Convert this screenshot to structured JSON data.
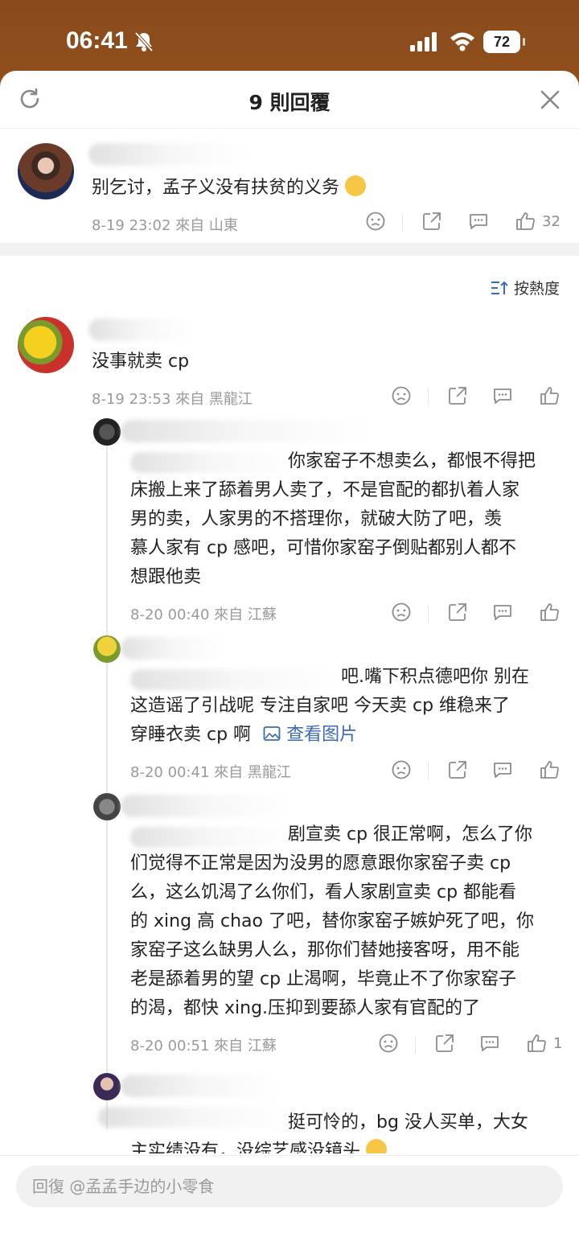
{
  "status_bar": {
    "time": "06:41",
    "battery": "72"
  },
  "header": {
    "title": "9 則回覆"
  },
  "root_comment": {
    "text": "别乞讨，孟子义没有扶贫的义务",
    "meta": "8-19 23:02  來自 山東",
    "likes": "32"
  },
  "sort_label": "按熱度",
  "comments": [
    {
      "text": "没事就卖 cp",
      "meta": "8-19 23:53  來自 黑龍江",
      "likes": ""
    }
  ],
  "replies": [
    {
      "lines": [
        "你家窑子不想卖么，都恨不得把",
        "床搬上来了舔着男人卖了，不是官配的都扒着人家",
        "男的卖，人家男的不搭理你，就破大防了吧，羡",
        "慕人家有 cp 感吧，可惜你家窑子倒贴都别人都不",
        "想跟他卖"
      ],
      "meta": "8-20 00:40  來自 江蘇",
      "likes": ""
    },
    {
      "lines": [
        "吧.嘴下积点德吧你  别在",
        "这造谣了引战呢 专注自家吧 今天卖 cp 维稳来了",
        "穿睡衣卖 cp 啊"
      ],
      "link": "查看图片",
      "meta": "8-20 00:41  來自 黑龍江",
      "likes": ""
    },
    {
      "lines": [
        "剧宣卖 cp 很正常啊，怎么了你",
        "们觉得不正常是因为没男的愿意跟你家窑子卖 cp",
        "么，这么饥渴了么你们，看人家剧宣卖 cp 都能看",
        "的 xing 高 chao 了吧，替你家窑子嫉妒死了吧，你",
        "家窑子这么缺男人么，那你们替她接客呀，用不能",
        "老是舔着男的望 cp 止渴啊，毕竟止不了你家窑子",
        "的渴，都快 xing.压抑到要舔人家有官配的了"
      ],
      "meta": "8-20 00:51  來自 江蘇",
      "likes": "1"
    },
    {
      "lines": [
        "挺可怜的，bg 没人买单，大女",
        "主实绩没有，没综艺感没镜头"
      ],
      "meta": "",
      "likes": ""
    }
  ],
  "reply_input": {
    "placeholder": "回復 @孟孟手边的小零食"
  },
  "colors": {
    "link": "#3b6bb5",
    "meta": "#9a9a9a"
  }
}
